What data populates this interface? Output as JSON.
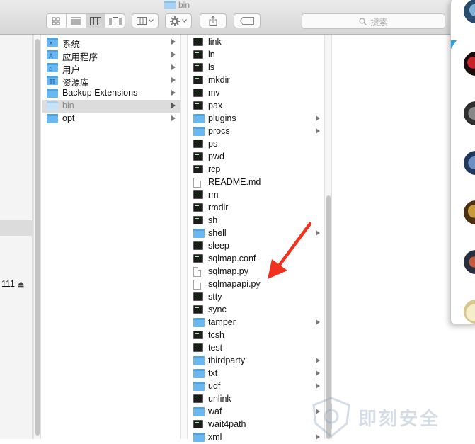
{
  "window": {
    "title": "bin"
  },
  "toolbar": {
    "view_buttons": [
      "icon-view",
      "list-view",
      "column-view",
      "cover-flow-view"
    ],
    "selected_view": "column-view",
    "arrange_icon": "grid-arrange-icon",
    "action_icon": "gear-icon",
    "share_icon": "share-icon",
    "tags_icon": "tag-icon",
    "search_placeholder": "搜索"
  },
  "left_pane": {
    "label": "111",
    "eject_icon": "eject-icon"
  },
  "column1": {
    "items": [
      {
        "label": "系统",
        "icon": "system-folder",
        "has_children": true
      },
      {
        "label": "应用程序",
        "icon": "applications-folder",
        "has_children": true
      },
      {
        "label": "用户",
        "icon": "users-folder",
        "has_children": true
      },
      {
        "label": "资源库",
        "icon": "library-folder",
        "has_children": true
      },
      {
        "label": "Backup Extensions",
        "icon": "folder",
        "has_children": true
      },
      {
        "label": "bin",
        "icon": "folder",
        "has_children": true,
        "selected": true
      },
      {
        "label": "opt",
        "icon": "folder",
        "has_children": true
      }
    ]
  },
  "column2": {
    "items": [
      {
        "label": "link",
        "icon": "terminal"
      },
      {
        "label": "ln",
        "icon": "terminal"
      },
      {
        "label": "ls",
        "icon": "terminal"
      },
      {
        "label": "mkdir",
        "icon": "terminal"
      },
      {
        "label": "mv",
        "icon": "terminal"
      },
      {
        "label": "pax",
        "icon": "terminal"
      },
      {
        "label": "plugins",
        "icon": "folder",
        "has_children": true
      },
      {
        "label": "procs",
        "icon": "folder",
        "has_children": true
      },
      {
        "label": "ps",
        "icon": "terminal"
      },
      {
        "label": "pwd",
        "icon": "terminal"
      },
      {
        "label": "rcp",
        "icon": "terminal"
      },
      {
        "label": "README.md",
        "icon": "document"
      },
      {
        "label": "rm",
        "icon": "terminal"
      },
      {
        "label": "rmdir",
        "icon": "terminal"
      },
      {
        "label": "sh",
        "icon": "terminal"
      },
      {
        "label": "shell",
        "icon": "folder",
        "has_children": true
      },
      {
        "label": "sleep",
        "icon": "terminal"
      },
      {
        "label": "sqlmap.conf",
        "icon": "terminal"
      },
      {
        "label": "sqlmap.py",
        "icon": "document"
      },
      {
        "label": "sqlmapapi.py",
        "icon": "document"
      },
      {
        "label": "stty",
        "icon": "terminal"
      },
      {
        "label": "sync",
        "icon": "terminal"
      },
      {
        "label": "tamper",
        "icon": "folder",
        "has_children": true
      },
      {
        "label": "tcsh",
        "icon": "terminal"
      },
      {
        "label": "test",
        "icon": "terminal"
      },
      {
        "label": "thirdparty",
        "icon": "folder",
        "has_children": true
      },
      {
        "label": "txt",
        "icon": "folder",
        "has_children": true
      },
      {
        "label": "udf",
        "icon": "folder",
        "has_children": true
      },
      {
        "label": "unlink",
        "icon": "terminal"
      },
      {
        "label": "waf",
        "icon": "folder",
        "has_children": true
      },
      {
        "label": "wait4path",
        "icon": "terminal"
      },
      {
        "label": "xml",
        "icon": "folder",
        "has_children": true
      }
    ]
  },
  "annotation": {
    "icon": "red-arrow-icon",
    "color": "#f0321e"
  },
  "side_popup": {
    "avatars": [
      "avatar-1",
      "avatar-2",
      "avatar-3",
      "avatar-4",
      "avatar-5",
      "avatar-6",
      "avatar-7"
    ]
  },
  "watermark": {
    "text": "即刻安全",
    "icon": "shield-logo-icon"
  },
  "colors": {
    "folder": "#6bb7ef",
    "selection": "#dcdcdc",
    "arrow": "#f0321e"
  }
}
